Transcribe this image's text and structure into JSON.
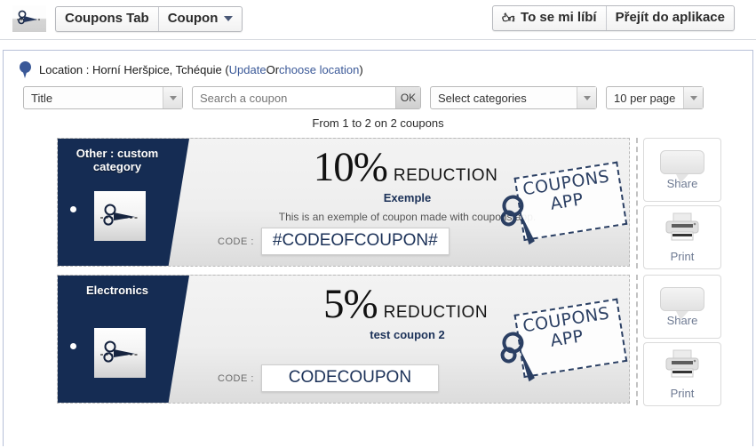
{
  "appbar": {
    "logo_icon": "scissors-icon",
    "tab_label": "Coupons Tab",
    "dropdown_label": "Coupon",
    "caret_icon": "chevron-down-icon",
    "like_icon": "thumbs-up-icon",
    "like_label": "To se mi líbí",
    "goto_app_label": "Přejít do aplikace"
  },
  "location": {
    "pin_icon": "map-pin-icon",
    "prefix": "Location : Horní Heršpice, Tchéquie (",
    "update_link": "Update",
    "separator": " Or ",
    "choose_link": "choose location",
    "suffix": ")"
  },
  "filters": {
    "sort_by": "Title",
    "search_placeholder": "Search a coupon",
    "search_value": "",
    "ok_label": "OK",
    "categories": "Select categories",
    "per_page": "10 per page",
    "arrow_icon": "chevron-down-icon"
  },
  "results_count": "From 1 to 2 on 2 coupons",
  "watermark": {
    "line1": "COUPONS",
    "line2": "APP",
    "icon": "scissors-icon"
  },
  "actions": {
    "share_label": "Share",
    "share_icon": "speech-bubble-icon",
    "print_label": "Print",
    "print_icon": "printer-icon"
  },
  "code_label": "CODE :",
  "reduction_label": "REDUCTION",
  "colors": {
    "navy": "#152C53",
    "link": "#3B5998",
    "title": "#1B3158",
    "body_bg": "#EEEEEE"
  },
  "coupons": [
    {
      "category": "Other : custom category",
      "category_icon": "scissors-icon",
      "percent": "10%",
      "title": "Exemple",
      "description": "This is an exemple of coupon made with coupons app.",
      "code": "#CODEOFCOUPON#"
    },
    {
      "category": "Electronics",
      "category_icon": "scissors-icon",
      "percent": "5%",
      "title": "test coupon 2",
      "description": "",
      "code": "CODECOUPON"
    }
  ]
}
